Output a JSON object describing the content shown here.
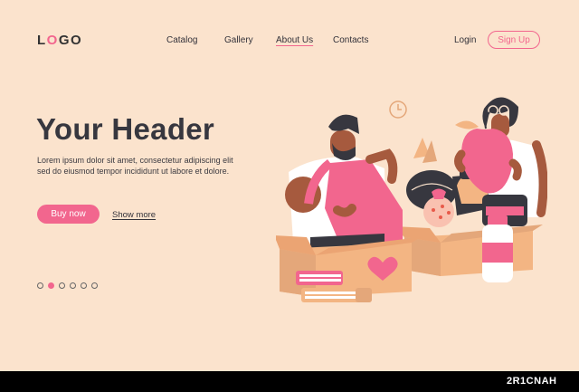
{
  "logo": {
    "l": "L",
    "o1": "O",
    "g": "G",
    "o2": "O"
  },
  "nav": {
    "catalog": "Catalog",
    "gallery": "Gallery",
    "about": "About Us",
    "contacts": "Contacts"
  },
  "auth": {
    "login": "Login",
    "signup": "Sign Up"
  },
  "hero": {
    "header": "Your Header",
    "body_line1": "Lorem ipsum dolor sit amet, consectetur adipiscing elit",
    "body_line2": "sed do eiusmod tempor incididunt ut labore et dolore.",
    "buy_label": "Buy now",
    "more_label": "Show more"
  },
  "pagination": {
    "count": 6,
    "active_index": 1
  },
  "watermark": "2R1CNAH",
  "colors": {
    "background": "#fbe3cd",
    "accent": "#f2668e",
    "box": "#f3b583",
    "dark": "#37373f"
  }
}
